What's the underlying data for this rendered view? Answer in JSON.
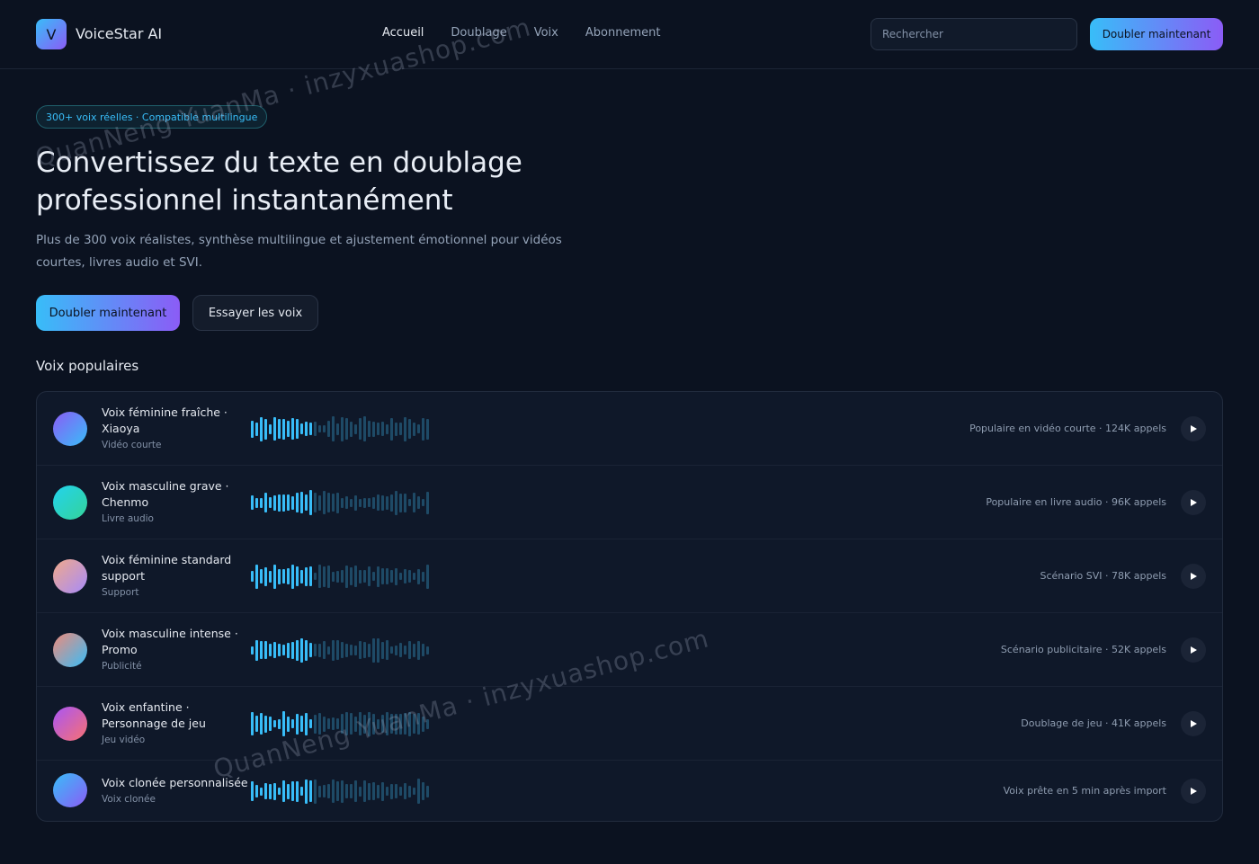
{
  "header": {
    "logo_letter": "V",
    "brand": "VoiceStar AI",
    "nav": [
      {
        "label": "Accueil",
        "active": true
      },
      {
        "label": "Doublage",
        "active": false
      },
      {
        "label": "Voix",
        "active": false
      },
      {
        "label": "Abonnement",
        "active": false
      }
    ],
    "search_placeholder": "Rechercher",
    "cta_label": "Doubler maintenant"
  },
  "hero": {
    "badge": "300+ voix réelles · Compatible multilingue",
    "title": "Convertissez du texte en doublage professionnel instantanément",
    "subtitle": "Plus de 300 voix réalistes, synthèse multilingue et ajustement émotionnel pour vidéos courtes, livres audio et SVI.",
    "primary_cta": "Doubler maintenant",
    "secondary_cta": "Essayer les voix"
  },
  "voices_section": {
    "title": "Voix populaires",
    "items": [
      {
        "name": "Voix féminine fraîche · Xiaoya",
        "tag": "Vidéo courte",
        "meta": "Populaire en vidéo courte · 124K appels",
        "gradient": [
          "#8b5cf6",
          "#38bdf8"
        ]
      },
      {
        "name": "Voix masculine grave · Chenmo",
        "tag": "Livre audio",
        "meta": "Populaire en livre audio · 96K appels",
        "gradient": [
          "#22d3ee",
          "#34d399"
        ]
      },
      {
        "name": "Voix féminine standard support",
        "tag": "Support",
        "meta": "Scénario SVI · 78K appels",
        "gradient": [
          "#f0a98a",
          "#a78bfa"
        ]
      },
      {
        "name": "Voix masculine intense · Promo",
        "tag": "Publicité",
        "meta": "Scénario publicitaire · 52K appels",
        "gradient": [
          "#f08a7a",
          "#38bdf8"
        ]
      },
      {
        "name": "Voix enfantine · Personnage de jeu",
        "tag": "Jeu vidéo",
        "meta": "Doublage de jeu · 41K appels",
        "gradient": [
          "#a855f7",
          "#f87171"
        ]
      },
      {
        "name": "Voix clonée personnalisée",
        "tag": "Voix clonée",
        "meta": "Voix prête en 5 min après import",
        "gradient": [
          "#38bdf8",
          "#8b5cf6"
        ]
      }
    ]
  },
  "colors": {
    "accent_cyan": "#38bdf8",
    "accent_violet": "#8b5cf6",
    "background": "#0b1220",
    "wave_active": "#38bdf8",
    "wave_inactive": "#1e4a66"
  },
  "watermarks": [
    "QuanNeng YuanMa · inzyxuashop.com",
    "QuanNeng YuanMa · inzyxuashop.com"
  ]
}
